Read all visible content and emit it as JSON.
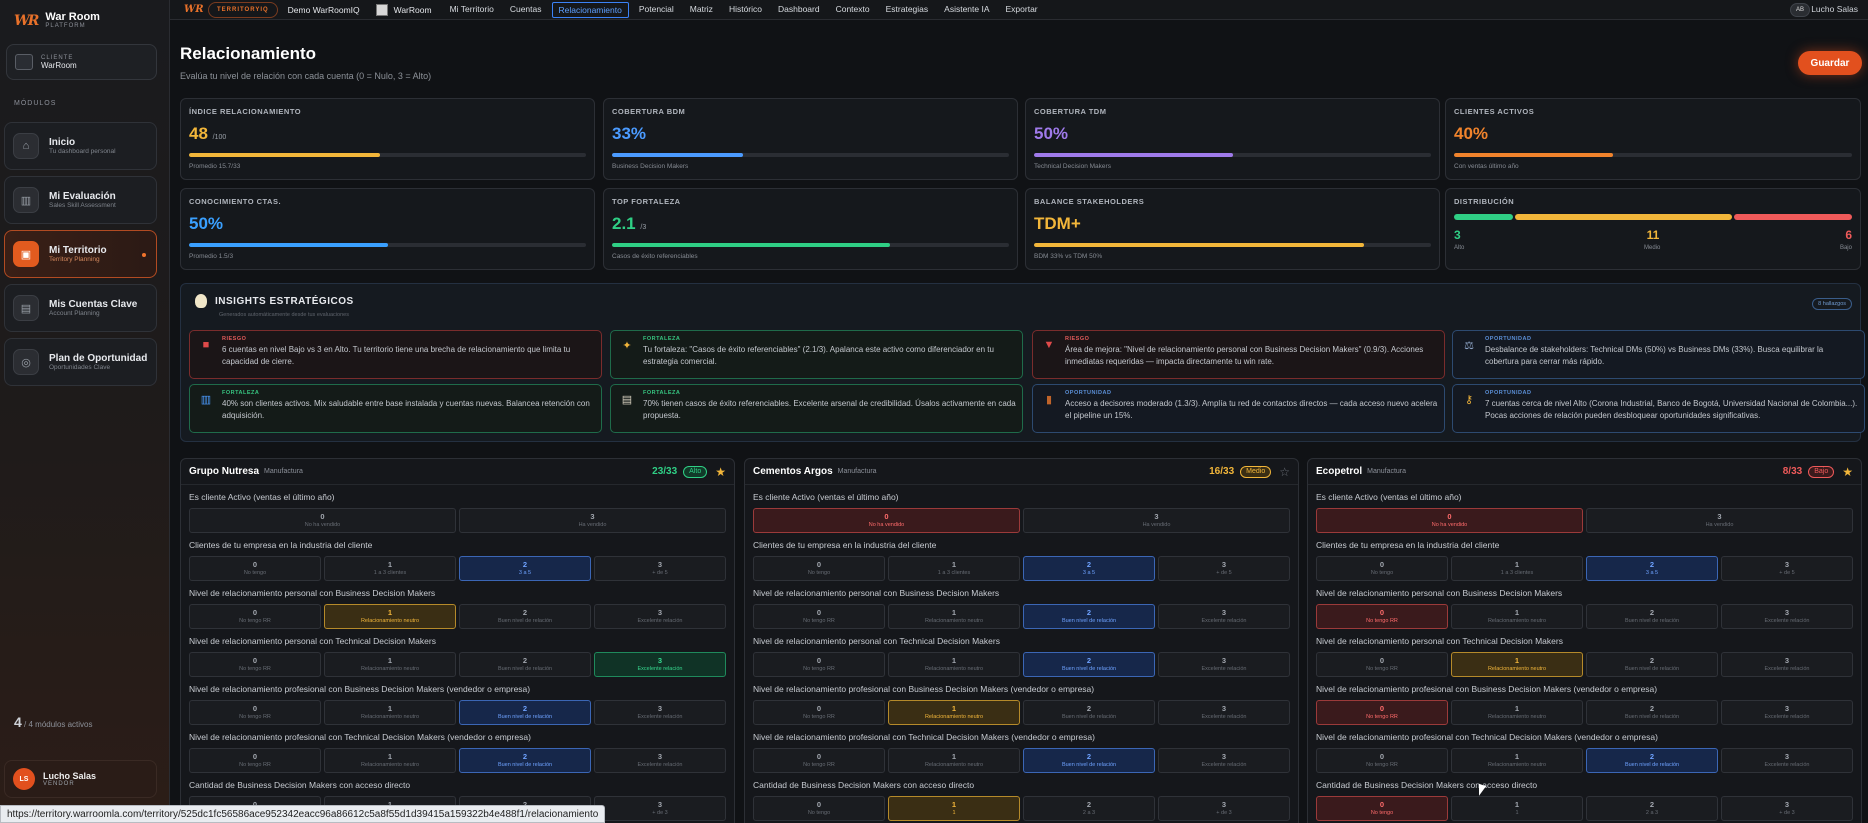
{
  "brand": {
    "name": "War Room",
    "sub": "PLATFORM",
    "logo": "WR"
  },
  "client": {
    "label": "CLIENTE",
    "value": "WarRoom"
  },
  "modules_title": "MÓDULOS",
  "nav": [
    {
      "label": "Inicio",
      "sub": "Tu dashboard personal",
      "icon": "home-icon",
      "glyph": "⌂"
    },
    {
      "label": "Mi Evaluación",
      "sub": "Sales Skill Assessment",
      "icon": "chart-icon",
      "glyph": "▥"
    },
    {
      "label": "Mi Territorio",
      "sub": "Territory Planning",
      "icon": "map-icon",
      "glyph": "▣",
      "active": true
    },
    {
      "label": "Mis Cuentas Clave",
      "sub": "Account Planning",
      "icon": "building-icon",
      "glyph": "▤"
    },
    {
      "label": "Plan de Oportunidad",
      "sub": "Oportunidades Clave",
      "icon": "target-icon",
      "glyph": "◎"
    }
  ],
  "modules_count": {
    "num": "4",
    "text": "/ 4 módulos activos"
  },
  "user": {
    "initials": "LS",
    "name": "Lucho Salas",
    "role": "VENDOR"
  },
  "topbar": {
    "logo": "WR",
    "pill": "TERRITORYIQ",
    "demo": "Demo WarRoomIQ",
    "workspace": "WarRoom",
    "tabs": [
      "Mi Territorio",
      "Cuentas",
      "Relacionamiento",
      "Potencial",
      "Matriz",
      "Histórico",
      "Dashboard",
      "Contexto",
      "Estrategias",
      "Asistente IA",
      "Exportar"
    ],
    "active_tab": 2,
    "avatar": "AB",
    "user": "Lucho Salas"
  },
  "page": {
    "title": "Relacionamiento",
    "subtitle": "Evalúa tu nivel de relación con cada cuenta (0 = Nulo, 3 = Alto)",
    "save": "Guardar"
  },
  "stats": [
    {
      "label": "ÍNDICE RELACIONAMIENTO",
      "value": "48",
      "suffix": "/100",
      "color": "#f2b63a",
      "fill": 0.48,
      "note": "Promedio 15.7/33"
    },
    {
      "label": "COBERTURA BDM",
      "value": "33%",
      "suffix": "",
      "color": "#4b9bff",
      "fill": 0.33,
      "note": "Business Decision Makers"
    },
    {
      "label": "COBERTURA TDM",
      "value": "50%",
      "suffix": "",
      "color": "#9f7aea",
      "fill": 0.5,
      "note": "Technical Decision Makers"
    },
    {
      "label": "CLIENTES ACTIVOS",
      "value": "40%",
      "suffix": "",
      "color": "#f0832c",
      "fill": 0.4,
      "note": "Con ventas último año"
    },
    {
      "label": "CONOCIMIENTO CTAS.",
      "value": "50%",
      "suffix": "",
      "color": "#3aa0ff",
      "fill": 0.5,
      "note": "Promedio 1.5/3"
    },
    {
      "label": "TOP FORTALEZA",
      "value": "2.1",
      "suffix": "/3",
      "color": "#2fcf85",
      "fill": 0.7,
      "note": "Casos de éxito referenciables"
    },
    {
      "label": "BALANCE STAKEHOLDERS",
      "value": "TDM+",
      "suffix": "",
      "color": "#f2b63a",
      "fill": 0.83,
      "note": "BDM 33% vs TDM 50%"
    }
  ],
  "distribution": {
    "label": "DISTRIBUCIÓN",
    "items": [
      {
        "n": "3",
        "l": "Alto",
        "color": "#2fcf85"
      },
      {
        "n": "11",
        "l": "Medio",
        "color": "#f2b63a"
      },
      {
        "n": "6",
        "l": "Bajo",
        "color": "#ef5a5a"
      }
    ]
  },
  "insights": {
    "title": "INSIGHTS ESTRATÉGICOS",
    "subtitle": "Generados automáticamente desde tus evaluaciones",
    "badge": "8 hallazgos",
    "items": [
      {
        "type": "riesgo",
        "tag": "RIESGO",
        "icon": "alert-icon",
        "glyph": "■",
        "icolor": "#e04a4a",
        "text": "6 cuentas en nivel Bajo vs 3 en Alto. Tu territorio tiene una brecha de relacionamiento que limita tu capacidad de cierre."
      },
      {
        "type": "fort",
        "tag": "FORTALEZA",
        "icon": "muscle-icon",
        "glyph": "✦",
        "icolor": "#f0b43a",
        "text": "Tu fortaleza: \"Casos de éxito referenciables\" (2.1/3). Apalanca este activo como diferenciador en tu estrategia comercial."
      },
      {
        "type": "riesgo",
        "tag": "RIESGO",
        "icon": "down-arrow-icon",
        "glyph": "▼",
        "icolor": "#e04a4a",
        "text": "Área de mejora: \"Nivel de relacionamiento personal con Business Decision Makers\" (0.9/3). Acciones inmediatas requeridas — impacta directamente tu win rate."
      },
      {
        "type": "opor",
        "tag": "OPORTUNIDAD",
        "icon": "scale-icon",
        "glyph": "⚖",
        "icolor": "#8fa6c8",
        "text": "Desbalance de stakeholders: Technical DMs (50%) vs Business DMs (33%). Busca equilibrar la cobertura para cerrar más rápido."
      },
      {
        "type": "fort",
        "tag": "FORTALEZA",
        "icon": "bar-chart-icon",
        "glyph": "▥",
        "icolor": "#4b9bff",
        "text": "40% son clientes activos. Mix saludable entre base instalada y cuentas nuevas. Balancea retención con adquisición."
      },
      {
        "type": "fort",
        "tag": "FORTALEZA",
        "icon": "clipboard-icon",
        "glyph": "▤",
        "icolor": "#d9d2c0",
        "text": "70% tienen casos de éxito referenciables. Excelente arsenal de credibilidad. Úsalos activamente en cada propuesta."
      },
      {
        "type": "opor",
        "tag": "OPORTUNIDAD",
        "icon": "door-icon",
        "glyph": "▮",
        "icolor": "#c0642a",
        "text": "Acceso a decisores moderado (1.3/3). Amplía tu red de contactos directos — cada acceso nuevo acelera el pipeline un 15%."
      },
      {
        "type": "opor",
        "tag": "OPORTUNIDAD",
        "icon": "key-icon",
        "glyph": "⚷",
        "icolor": "#f0b43a",
        "text": "7 cuentas cerca de nivel Alto (Corona Industrial, Banco de Bogotá, Universidad Nacional de Colombia...). Pocas acciones de relación pueden desbloquear oportunidades significativas."
      }
    ]
  },
  "questions": [
    {
      "label": "Es cliente Activo (ventas el último año)",
      "opts": [
        {
          "n": "0",
          "t": "No ha vendido"
        },
        {
          "n": "3",
          "t": "Ha vendido"
        }
      ]
    },
    {
      "label": "Clientes de tu empresa en la industria del cliente",
      "opts": [
        {
          "n": "0",
          "t": "No tengo"
        },
        {
          "n": "1",
          "t": "1 a 3 clientes"
        },
        {
          "n": "2",
          "t": "3 a 5"
        },
        {
          "n": "3",
          "t": "+ de 5"
        }
      ]
    },
    {
      "label": "Nivel de relacionamiento personal con Business Decision Makers",
      "opts": [
        {
          "n": "0",
          "t": "No tengo RR"
        },
        {
          "n": "1",
          "t": "Relacionamiento neutro"
        },
        {
          "n": "2",
          "t": "Buen nivel de relación"
        },
        {
          "n": "3",
          "t": "Excelente relación"
        }
      ]
    },
    {
      "label": "Nivel de relacionamiento personal con Technical Decision Makers",
      "opts": [
        {
          "n": "0",
          "t": "No tengo RR"
        },
        {
          "n": "1",
          "t": "Relacionamiento neutro"
        },
        {
          "n": "2",
          "t": "Buen nivel de relación"
        },
        {
          "n": "3",
          "t": "Excelente relación"
        }
      ]
    },
    {
      "label": "Nivel de relacionamiento profesional con Business Decision Makers (vendedor o empresa)",
      "opts": [
        {
          "n": "0",
          "t": "No tengo RR"
        },
        {
          "n": "1",
          "t": "Relacionamiento neutro"
        },
        {
          "n": "2",
          "t": "Buen nivel de relación"
        },
        {
          "n": "3",
          "t": "Excelente relación"
        }
      ]
    },
    {
      "label": "Nivel de relacionamiento profesional con Technical Decision Makers (vendedor o empresa)",
      "opts": [
        {
          "n": "0",
          "t": "No tengo RR"
        },
        {
          "n": "1",
          "t": "Relacionamiento neutro"
        },
        {
          "n": "2",
          "t": "Buen nivel de relación"
        },
        {
          "n": "3",
          "t": "Excelente relación"
        }
      ]
    },
    {
      "label": "Cantidad de Business Decision Makers con acceso directo",
      "opts": [
        {
          "n": "0",
          "t": "No tengo"
        },
        {
          "n": "1",
          "t": "1"
        },
        {
          "n": "2",
          "t": "2 a 3"
        },
        {
          "n": "3",
          "t": "+ de 3"
        }
      ]
    }
  ],
  "accounts": [
    {
      "name": "Grupo Nutresa",
      "industry": "Manufactura",
      "score": "23/33",
      "level": "Alto",
      "level_color": "#2fcf85",
      "level_bg": "#113a29",
      "starred": true,
      "selected": [
        1,
        2,
        1,
        3,
        2,
        2,
        null
      ]
    },
    {
      "name": "Cementos Argos",
      "industry": "Manufactura",
      "score": "16/33",
      "level": "Medio",
      "level_color": "#f2b63a",
      "level_bg": "#3a2e14",
      "starred": false,
      "selected": [
        0,
        2,
        2,
        2,
        1,
        2,
        1
      ]
    },
    {
      "name": "Ecopetrol",
      "industry": "Manufactura",
      "score": "8/33",
      "level": "Bajo",
      "level_color": "#ef5a5a",
      "level_bg": "#3a1a1c",
      "starred": true,
      "selected": [
        0,
        2,
        0,
        1,
        0,
        2,
        0
      ]
    }
  ],
  "status_url": "https://territory.warroomla.com/territory/525dc1fc56586ace952342eacc96a86612c5a8f55d1d39415a159322b4e488f1/relacionamiento"
}
